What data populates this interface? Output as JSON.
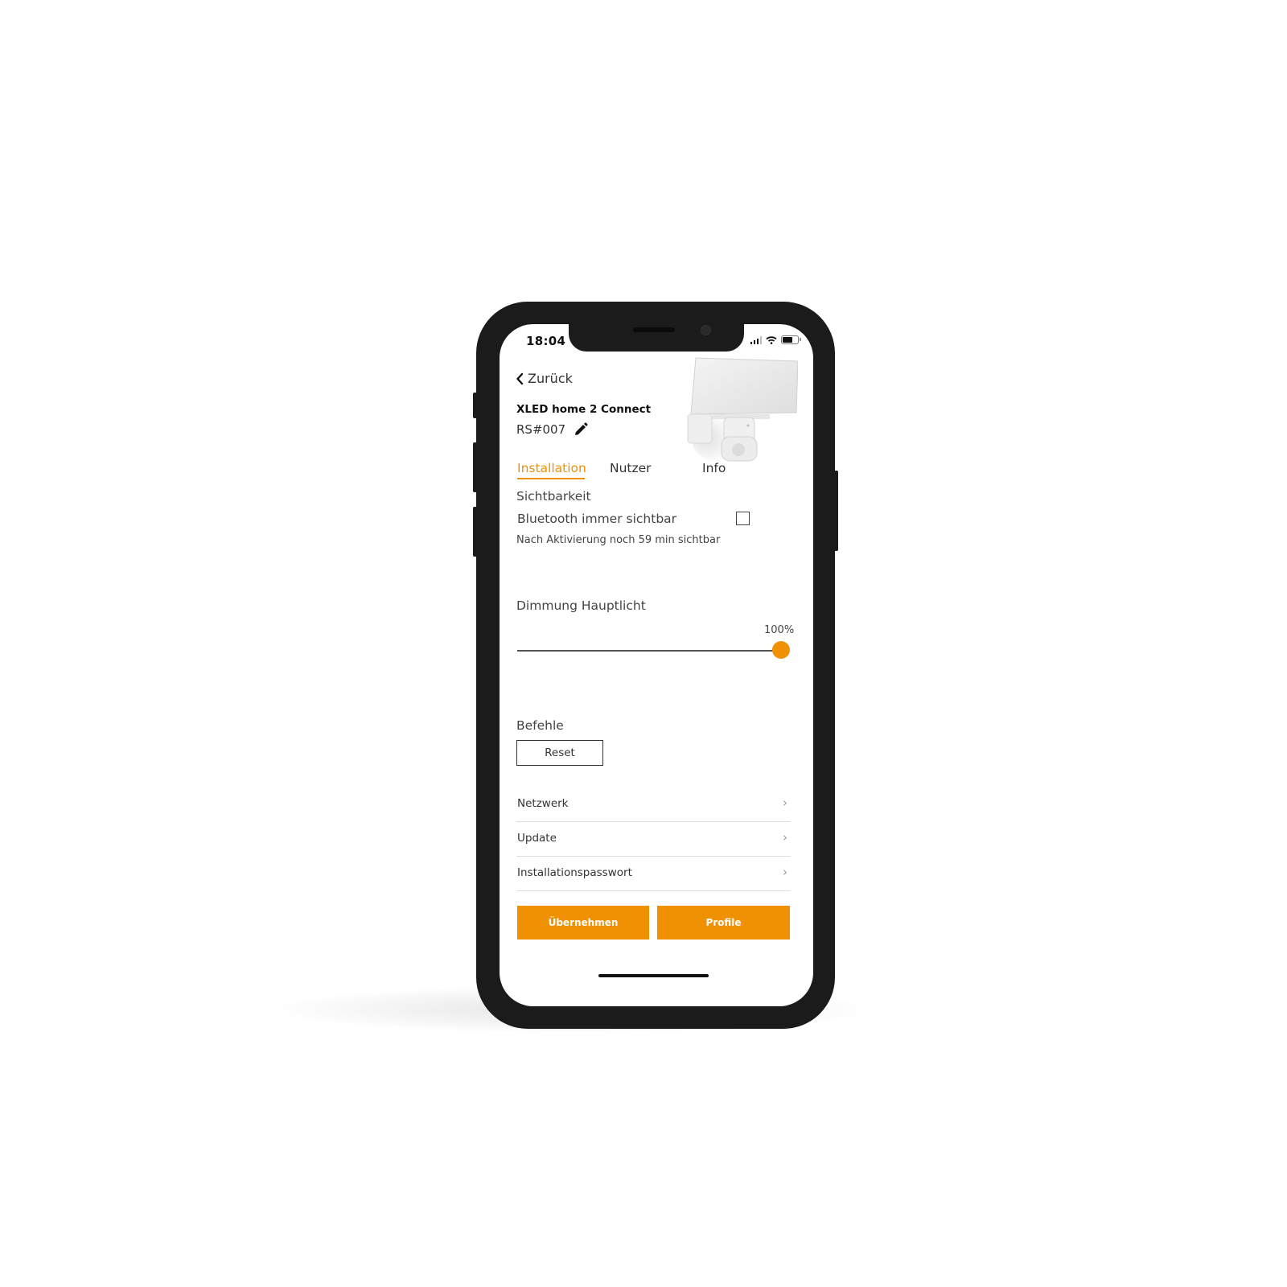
{
  "status_bar": {
    "time": "18:04",
    "icons": [
      "signal-icon",
      "wifi-icon",
      "battery-icon"
    ]
  },
  "nav": {
    "back_label": "Zurück",
    "back_icon": "chevron-left-icon"
  },
  "device": {
    "name": "XLED home 2 Connect",
    "id": "RS#007",
    "edit_icon": "pencil-icon",
    "image": "floodlight-product-image"
  },
  "tabs": [
    {
      "label": "Installation",
      "active": true
    },
    {
      "label": "Nutzer",
      "active": false
    },
    {
      "label": "Info",
      "active": false
    }
  ],
  "visibility": {
    "heading": "Sichtbarkeit",
    "option_label": "Bluetooth immer sichtbar",
    "checked": false,
    "note": "Nach Aktivierung noch 59 min sichtbar"
  },
  "dimming": {
    "heading": "Dimmung Hauptlicht",
    "value_label": "100%",
    "value": 100
  },
  "commands": {
    "heading": "Befehle",
    "reset_label": "Reset"
  },
  "menu": [
    {
      "label": "Netzwerk"
    },
    {
      "label": "Update"
    },
    {
      "label": "Installationspasswort"
    }
  ],
  "actions": {
    "apply_label": "Übernehmen",
    "profiles_label": "Profile"
  },
  "colors": {
    "accent": "#f09104",
    "phone_frame": "#1b1b1b",
    "text": "#333333"
  }
}
